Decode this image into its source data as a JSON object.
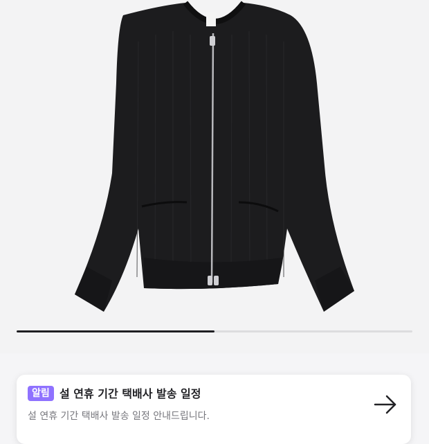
{
  "product": {
    "image_icon": "black-zip-knit-cardigan-photo"
  },
  "carousel": {
    "progress": 0.5
  },
  "notice": {
    "badge": "알림",
    "title": "설 연휴 기간 택배사 발송 일정",
    "subtitle": "설 연휴 기간 택배사 발송 일정 안내드립니다.",
    "arrow_icon": "arrow-right-icon"
  },
  "colors": {
    "badge_bg": "#8f72ff",
    "progress_fill": "#1e1e22",
    "progress_track": "#dcdcde",
    "page_bg": "#f5f5f7"
  }
}
